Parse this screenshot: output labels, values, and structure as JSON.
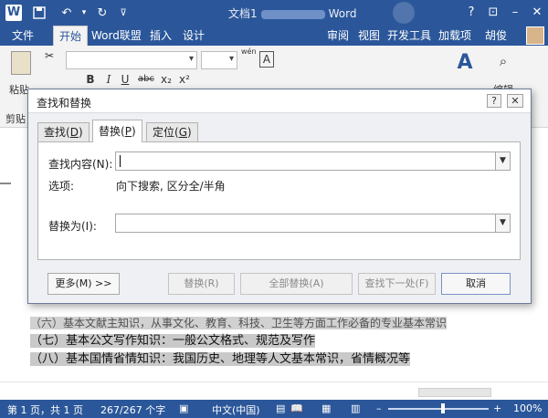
{
  "window": {
    "app_name": "Word",
    "doc_title_prefix": "文档1",
    "icon_word": "W",
    "quick_access": [
      "save-icon",
      "undo-icon",
      "redo-icon"
    ],
    "controls": [
      "?",
      "–",
      "□",
      "✕"
    ]
  },
  "ribbon_tabs": {
    "file": "文件",
    "home": "开始",
    "wordlink": "Word联盟",
    "insert": "插入",
    "design": "设计",
    "review": "审阅",
    "view": "视图",
    "developer": "开发工具",
    "addins": "加载项",
    "user": "胡俊"
  },
  "ribbon": {
    "paste_label": "粘贴",
    "clipboard_group": "剪贴",
    "edit_label": "编辑",
    "bold": "B",
    "italic": "I",
    "underline": "U",
    "strike": "abc",
    "subscript": "x₂",
    "superscript": "x²",
    "font_a": "A",
    "wen_label": "wén"
  },
  "dialog": {
    "title": "查找和替换",
    "help": "?",
    "close": "✕",
    "tabs": [
      {
        "label": "查找(",
        "key": "D",
        "tail": ")"
      },
      {
        "label": "替换(",
        "key": "P",
        "tail": ")"
      },
      {
        "label": "定位(",
        "key": "G",
        "tail": ")"
      }
    ],
    "find_label": "查找内容(N):",
    "find_value": "",
    "options_label": "选项:",
    "options_value": "向下搜索, 区分全/半角",
    "replace_label": "替换为(I):",
    "replace_value": "",
    "buttons": {
      "more": "更多(M) >>",
      "replace": "替换(R)",
      "replace_all": "全部替换(A)",
      "find_next": "查找下一处(F)",
      "cancel": "取消"
    }
  },
  "document": {
    "partial_line": "（六）基本文献主知识，从事文化、教育、科技、卫生等方面工作必备的专业基本常识",
    "line_7": "（七）基本公文写作知识：一般公文格式、规范及写作",
    "line_8": "（八）基本国情省情知识：我国历史、地理等人文基本常识，省情概况等"
  },
  "status": {
    "page": "第 1 页，共 1 页",
    "words": "267/267 个字",
    "language": "中文(中国)",
    "zoom": "100%",
    "zoom_minus": "–",
    "zoom_plus": "+"
  },
  "colors": {
    "accent": "#2b579a",
    "selection": "#c9c9c9"
  }
}
